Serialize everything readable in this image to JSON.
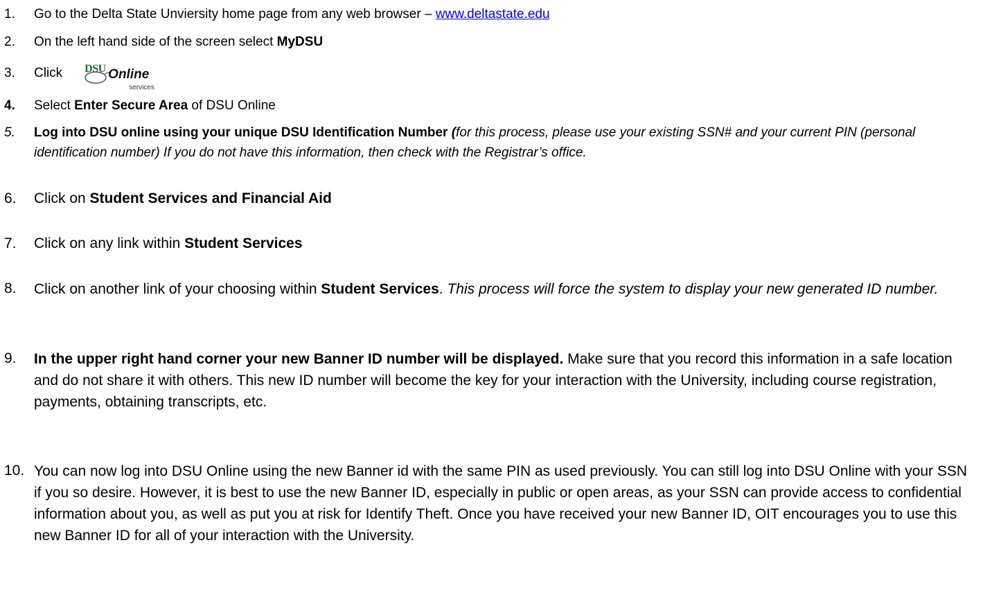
{
  "steps": [
    {
      "n": "1.",
      "pre": "Go to the Delta State Unviersity home page from any web browser – ",
      "link": "www.deltastate.edu"
    },
    {
      "n": "2.",
      "pre": "On the left hand side of the screen select  ",
      "bold": "MyDSU"
    },
    {
      "n": "3.",
      "pre": "Click",
      "logo": {
        "dsu": "DSU",
        "online": "Online",
        "services": "services"
      }
    },
    {
      "n": "4.",
      "pre": "Select ",
      "bold": "Enter Secure Area",
      "post": " of DSU Online"
    },
    {
      "n": "5.",
      "bold": "Log into DSU online using your unique DSU Identification Number ",
      "italic_bold": "(",
      "italic": "for this process, please use your existing SSN# and your current PIN (personal identification number) If you do not have this information, then check with the Registrar’s office."
    },
    {
      "n": "6.",
      "pre": "Click on ",
      "bold": "Student Services and Financial Aid"
    },
    {
      "n": "7.",
      "pre": "Click on any link within ",
      "bold": "Student Services"
    },
    {
      "n": "8.",
      "pre": "Click on another link of your choosing within ",
      "bold": "Student Services",
      "post": ".  ",
      "italic": "This process will force the system to display your new generated ID number."
    },
    {
      "n": "9.",
      "bold": "In the upper right hand corner your new Banner ID number will be displayed.",
      "post": "  Make sure that you record this information in a safe location and do not share it with others.  This new ID number will become the key for your interaction with the University, including course registration, payments, obtaining transcripts, etc."
    },
    {
      "n": "10.",
      "pre": "You can now log into DSU Online using the new Banner id with the same PIN as used previously.   You can still log into DSU Online with your SSN if you so desire.  However, it is best to use the new Banner ID, especially in public or open areas, as your SSN can provide access to confidential information about you, as well as put you at risk for Identify Theft.  Once you have received your new Banner ID, OIT encourages you to use this new Banner ID for all of your interaction with the University."
    }
  ]
}
